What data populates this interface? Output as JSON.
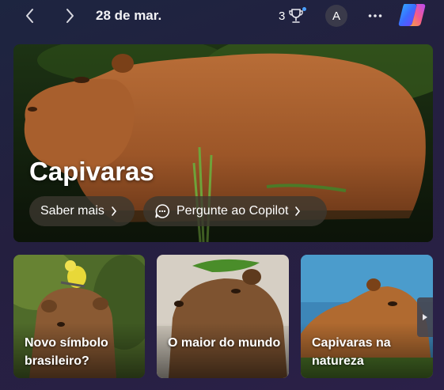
{
  "header": {
    "date": "28 de mar.",
    "rewards_count": "3",
    "avatar_initial": "A",
    "icons": [
      "chevron-left-icon",
      "chevron-right-icon",
      "trophy-icon",
      "more-icon",
      "copilot-logo-icon"
    ]
  },
  "hero": {
    "title": "Capivaras",
    "learn_more_label": "Saber mais",
    "ask_copilot_label": "Pergunte ao Copilot"
  },
  "cards": [
    {
      "title": "Novo símbolo brasileiro?"
    },
    {
      "title": "O maior do mundo"
    },
    {
      "title": "Capivaras na natureza"
    }
  ],
  "colors": {
    "background": "#241f3f",
    "pill_background": "#3c3830",
    "capybara_fur": "#a4612f",
    "notification_dot": "#4aa0ff"
  }
}
